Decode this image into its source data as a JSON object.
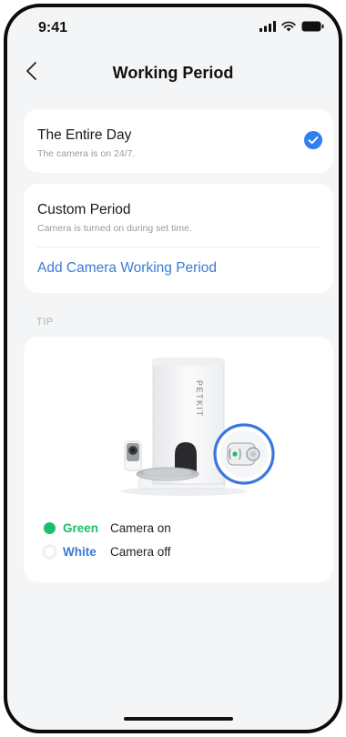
{
  "status_bar": {
    "time": "9:41"
  },
  "header": {
    "title": "Working Period"
  },
  "options": [
    {
      "title": "The Entire Day",
      "subtitle": "The camera is on 24/7.",
      "selected": true
    },
    {
      "title": "Custom Period",
      "subtitle": "Camera is turned on during set time.",
      "selected": false
    }
  ],
  "add_period_label": "Add Camera Working Period",
  "tip": {
    "label": "TIP",
    "device_brand": "PETKIT",
    "legend": [
      {
        "name": "Green",
        "description": "Camera on",
        "color": "#1bbf6a"
      },
      {
        "name": "White",
        "description": "Camera off",
        "color": "#3a7bd5"
      }
    ]
  },
  "colors": {
    "accent": "#2f7ff0",
    "link": "#3a7bd5",
    "background": "#f4f5f7"
  }
}
